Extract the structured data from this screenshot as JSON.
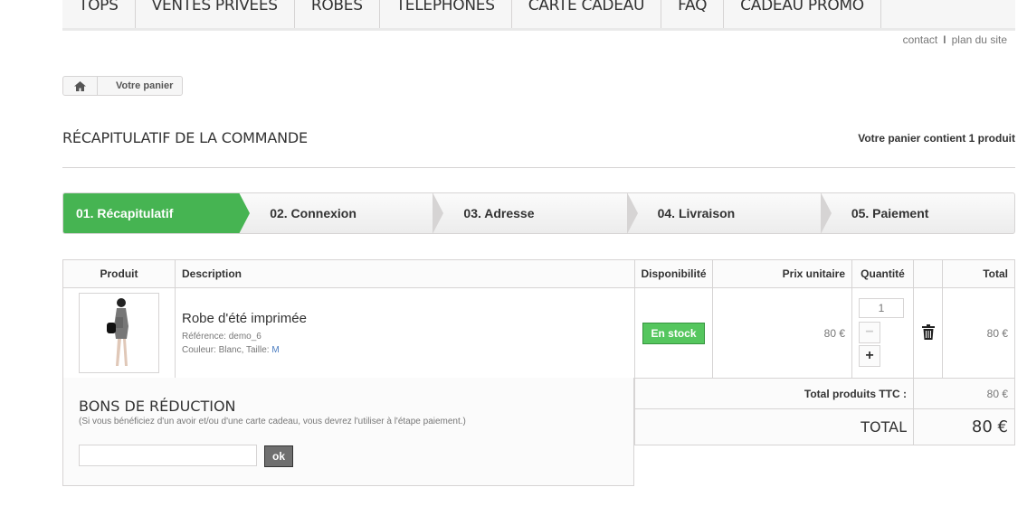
{
  "nav": [
    "TOPS",
    "VENTES PRIVEES",
    "ROBES",
    "TELEPHONES",
    "CARTE CADEAU",
    "FAQ",
    "CADEAU PROMO"
  ],
  "links": {
    "contact": "contact",
    "sep": "I",
    "sitemap": "plan du site"
  },
  "breadcrumb": {
    "current": "Votre panier"
  },
  "page_title": "RÉCAPITULATIF DE LA COMMANDE",
  "cart_count": "Votre panier contient 1 produit",
  "steps": [
    "01. Récapitulatif",
    "02. Connexion",
    "03. Adresse",
    "04. Livraison",
    "05. Paiement"
  ],
  "table": {
    "headers": {
      "product": "Produit",
      "description": "Description",
      "availability": "Disponibilité",
      "unit_price": "Prix unitaire",
      "quantity": "Quantité",
      "total": "Total"
    },
    "item": {
      "name": "Robe d'été imprimée",
      "reference": "Référence: demo_6",
      "attributes_prefix": "Couleur: Blanc, Taille: ",
      "size": "M",
      "availability": "En stock",
      "unit_price": "80 €",
      "quantity": "1",
      "total": "80 €"
    }
  },
  "totals": {
    "products_label": "Total produits TTC :",
    "products_value": "80 €",
    "total_label": "TOTAL",
    "total_value": "80 €"
  },
  "vouchers": {
    "title": "BONS DE RÉDUCTION",
    "note": "(Si vous bénéficiez d'un avoir et/ou d'une carte cadeau, vous devrez l'utiliser à l'étape paiement.)",
    "input_value": "",
    "button": "ok"
  },
  "colors": {
    "accent": "#46b452",
    "stock": "#55c65e"
  }
}
